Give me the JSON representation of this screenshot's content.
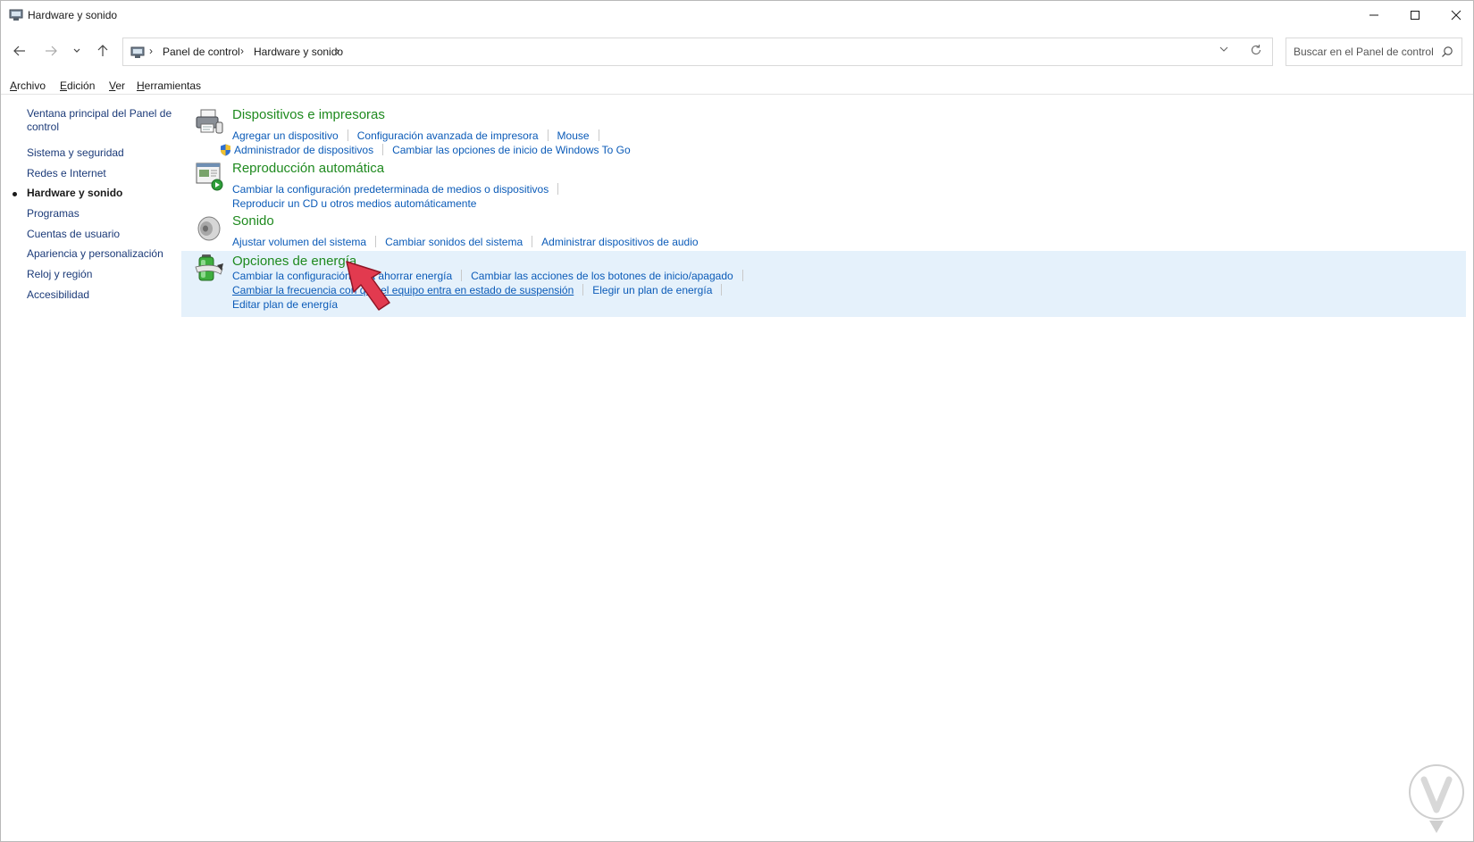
{
  "window": {
    "title": "Hardware y sonido",
    "controls": {
      "minimize": "—",
      "maximize": "☐",
      "close": "✕"
    }
  },
  "navigation": {
    "back_icon": "arrow-left-icon",
    "forward_icon": "arrow-right-icon",
    "recent_icon": "chevron-down-icon",
    "up_icon": "arrow-up-icon",
    "breadcrumb": [
      "Panel de control",
      "Hardware y sonido"
    ],
    "search_placeholder": "Buscar en el Panel de control"
  },
  "menu": {
    "items": [
      {
        "accel": "A",
        "rest": "rchivo"
      },
      {
        "accel": "E",
        "rest": "dición"
      },
      {
        "accel": "V",
        "rest": "er"
      },
      {
        "accel": "H",
        "rest": "erramientas"
      }
    ]
  },
  "sidebar": {
    "items": [
      {
        "label": "Ventana principal del Panel de control",
        "active": false
      },
      {
        "label": "Sistema y seguridad",
        "active": false
      },
      {
        "label": "Redes e Internet",
        "active": false
      },
      {
        "label": "Hardware y sonido",
        "active": true
      },
      {
        "label": "Programas",
        "active": false
      },
      {
        "label": "Cuentas de usuario",
        "active": false
      },
      {
        "label": "Apariencia y personalización",
        "active": false
      },
      {
        "label": "Reloj y región",
        "active": false
      },
      {
        "label": "Accesibilidad",
        "active": false
      }
    ]
  },
  "categories": [
    {
      "title": "Dispositivos e impresoras",
      "icon": "printer-icon",
      "links": [
        "Agregar un dispositivo",
        "Configuración avanzada de impresora",
        "Mouse",
        "Administrador de dispositivos",
        "Cambiar las opciones de inicio de Windows To Go"
      ]
    },
    {
      "title": "Reproducción automática",
      "icon": "autoplay-icon",
      "links": [
        "Cambiar la configuración predeterminada de medios o dispositivos",
        "Reproducir un CD u otros medios automáticamente"
      ]
    },
    {
      "title": "Sonido",
      "icon": "speaker-icon",
      "links": [
        "Ajustar volumen del sistema",
        "Cambiar sonidos del sistema",
        "Administrar dispositivos de audio"
      ]
    },
    {
      "title": "Opciones de energía",
      "icon": "battery-icon",
      "highlighted": true,
      "links": [
        "Cambiar la configuración para ahorrar energía",
        "Cambiar las acciones de los botones de inicio/apagado",
        "Cambiar la frecuencia con que el equipo entra en estado de suspensión",
        "Elegir un plan de energía",
        "Editar plan de energía"
      ]
    }
  ],
  "colors": {
    "category_title": "#1f8a1f",
    "link": "#0b5bb8",
    "highlight_bg": "#e5f1fb",
    "pointer": "#e23a4f"
  }
}
